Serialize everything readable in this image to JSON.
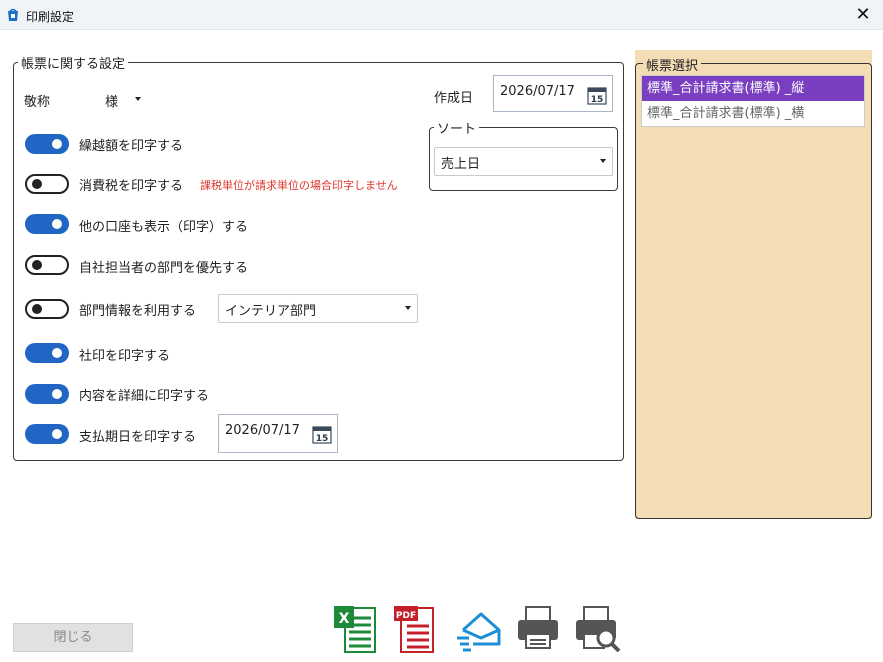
{
  "window": {
    "title": "印刷設定",
    "close_glyph": "✕"
  },
  "settings_group": {
    "legend": "帳票に関する設定",
    "honorific": {
      "label": "敬称",
      "value": "様"
    },
    "created_date": {
      "label": "作成日",
      "value": "2026/07/17",
      "calendar_day": "15"
    },
    "sort": {
      "legend": "ソート",
      "value": "売上日"
    },
    "options": [
      {
        "label": "繰越額を印字する",
        "on": true
      },
      {
        "label": "消費税を印字する",
        "on": false,
        "note": "課税単位が請求単位の場合印字しません"
      },
      {
        "label": "他の口座も表示（印字）する",
        "on": true
      },
      {
        "label": "自社担当者の部門を優先する",
        "on": false
      },
      {
        "label": "部門情報を利用する",
        "on": false,
        "select_value": "インテリア部門"
      },
      {
        "label": "社印を印字する",
        "on": true
      },
      {
        "label": "内容を詳細に印字する",
        "on": true
      },
      {
        "label": "支払期日を印字する",
        "on": true,
        "date_value": "2026/07/17",
        "calendar_day": "15"
      }
    ]
  },
  "form_select": {
    "legend": "帳票選択",
    "items": [
      {
        "label": "標準_合計請求書(標準) _縦",
        "selected": true
      },
      {
        "label": "標準_合計請求書(標準) _横",
        "selected": false
      }
    ]
  },
  "footer": {
    "close_label": "閉じる",
    "icons": [
      "excel-icon",
      "pdf-icon",
      "email-icon",
      "print-icon",
      "print-preview-icon"
    ],
    "icon_text": {
      "excel": "X",
      "pdf": "PDF"
    }
  },
  "colors": {
    "toggle_on": "#2166c4",
    "selected_item": "#7a3fc0",
    "panel_bg": "#f4ddb5",
    "warning": "#e0342c",
    "excel_green": "#1d8a3a",
    "pdf_red": "#c4202a",
    "mail_blue": "#1d8fd6"
  }
}
